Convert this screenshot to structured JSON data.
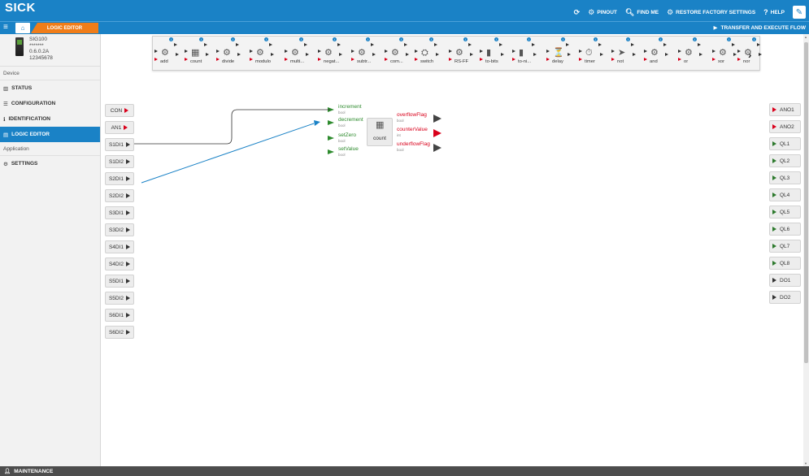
{
  "brand": {
    "logo": "SICK",
    "accent": "#1a82c6",
    "tab_orange": "#f07d19"
  },
  "topbar": {
    "items": [
      {
        "label": "",
        "icon": "refresh-icon"
      },
      {
        "label": "PINOUT",
        "icon": "gears-icon"
      },
      {
        "label": "FIND ME",
        "icon": "search-icon"
      },
      {
        "label": "RESTORE FACTORY SETTINGS",
        "icon": "gears-icon"
      },
      {
        "label": "HELP",
        "icon": "question-icon"
      }
    ],
    "edit_icon": "pencil-icon"
  },
  "nav": {
    "tab_label": "LOGIC EDITOR",
    "transfer_label": "TRANSFER AND EXECUTE FLOW"
  },
  "device": {
    "name": "SIG100",
    "password": "*******",
    "version": "0.6.0.2A",
    "serial": "12345678"
  },
  "sidebar": {
    "device_title": "Device",
    "device_items": [
      {
        "label": "STATUS",
        "icon": "bar-chart-icon"
      },
      {
        "label": "CONFIGURATION",
        "icon": "list-icon"
      },
      {
        "label": "IDENTIFICATION",
        "icon": "info-icon"
      },
      {
        "label": "LOGIC EDITOR",
        "icon": "diagram-icon",
        "active": true
      }
    ],
    "app_title": "Application",
    "app_items": [
      {
        "label": "SETTINGS",
        "icon": "gears-icon"
      }
    ],
    "footer": "MAINTENANCE"
  },
  "palette": [
    {
      "label": "add",
      "icon": "gear-icon"
    },
    {
      "label": "count",
      "icon": "counter-icon"
    },
    {
      "label": "divide",
      "icon": "gear-icon"
    },
    {
      "label": "modulo",
      "icon": "gear-icon"
    },
    {
      "label": "multi...",
      "icon": "gear-icon"
    },
    {
      "label": "negat...",
      "icon": "gear-icon"
    },
    {
      "label": "subtr...",
      "icon": "gear-icon"
    },
    {
      "label": "com...",
      "icon": "gear-icon"
    },
    {
      "label": "switch",
      "icon": "switch-icon"
    },
    {
      "label": "RS-FF",
      "icon": "gear-icon"
    },
    {
      "label": "to-bits",
      "icon": "bits-icon"
    },
    {
      "label": "to-ni...",
      "icon": "bits-icon"
    },
    {
      "label": "delay",
      "icon": "delay-icon"
    },
    {
      "label": "timer",
      "icon": "timer-icon"
    },
    {
      "label": "not",
      "icon": "not-icon"
    },
    {
      "label": "and",
      "icon": "gear-icon"
    },
    {
      "label": "or",
      "icon": "gear-icon"
    },
    {
      "label": "xor",
      "icon": "gear-icon"
    },
    {
      "label": "nor",
      "icon": "gear-icon"
    }
  ],
  "inputs": [
    {
      "label": "CON",
      "type": "red"
    },
    {
      "label": "AN1",
      "type": "red"
    },
    {
      "label": "S1DI1",
      "type": "black"
    },
    {
      "label": "S1DI2",
      "type": "black"
    },
    {
      "label": "S2DI1",
      "type": "black"
    },
    {
      "label": "S2DI2",
      "type": "black"
    },
    {
      "label": "S3DI1",
      "type": "black"
    },
    {
      "label": "S3DI2",
      "type": "black"
    },
    {
      "label": "S4DI1",
      "type": "black"
    },
    {
      "label": "S4DI2",
      "type": "black"
    },
    {
      "label": "S5DI1",
      "type": "black"
    },
    {
      "label": "S5DI2",
      "type": "black"
    },
    {
      "label": "S6DI1",
      "type": "black"
    },
    {
      "label": "S6DI2",
      "type": "black"
    }
  ],
  "outputs": [
    {
      "label": "ANO1",
      "type": "red"
    },
    {
      "label": "ANO2",
      "type": "red"
    },
    {
      "label": "QL1",
      "type": "green"
    },
    {
      "label": "QL2",
      "type": "green"
    },
    {
      "label": "QL3",
      "type": "green"
    },
    {
      "label": "QL4",
      "type": "green"
    },
    {
      "label": "QL5",
      "type": "green"
    },
    {
      "label": "QL6",
      "type": "green"
    },
    {
      "label": "QL7",
      "type": "green"
    },
    {
      "label": "QL8",
      "type": "green"
    },
    {
      "label": "DO1",
      "type": "black"
    },
    {
      "label": "DO2",
      "type": "black"
    }
  ],
  "block": {
    "name": "count",
    "icon": "counter-icon",
    "inputs": [
      {
        "name": "increment",
        "type": "bool"
      },
      {
        "name": "decrement",
        "type": "bool"
      },
      {
        "name": "setZero",
        "type": "bool"
      },
      {
        "name": "setValue",
        "type": "bool"
      }
    ],
    "outputs": [
      {
        "name": "overflowFlag",
        "type": "bool",
        "color": "gray"
      },
      {
        "name": "counterValue",
        "type": "int",
        "color": "red"
      },
      {
        "name": "underflowFlag",
        "type": "bool",
        "color": "gray"
      }
    ]
  },
  "wires": [
    {
      "from": "S1DI1",
      "to": "increment",
      "color": "#333333"
    },
    {
      "from": "S2DI1",
      "to": "decrement",
      "color": "#1a82c6"
    }
  ]
}
